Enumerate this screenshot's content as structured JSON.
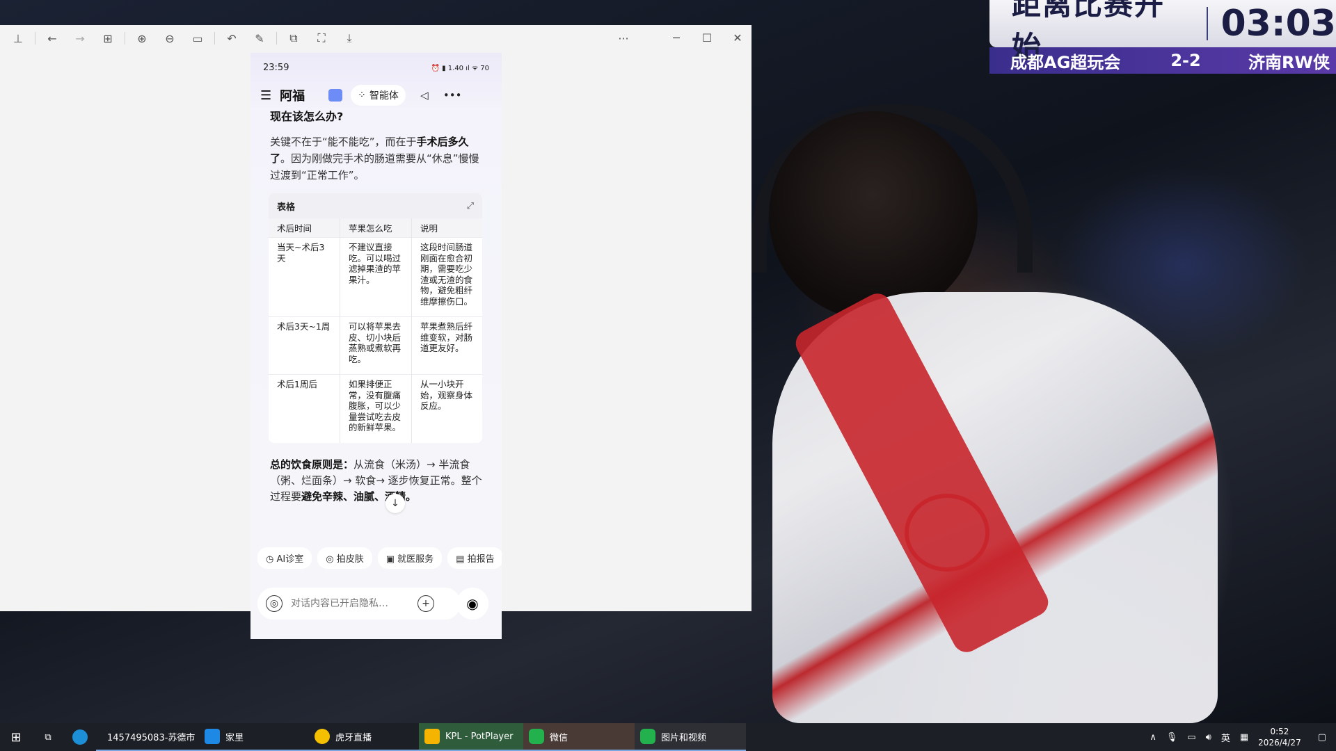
{
  "scoreboard": {
    "title": "距离比赛开始",
    "time": "03:03",
    "team_left": "成都AG超玩会",
    "score": "2-2",
    "team_right": "济南RW侠"
  },
  "viewer": {
    "toolbar_icons": [
      "pin-icon",
      "back-icon",
      "forward-icon",
      "grid-icon",
      "zoom-in-icon",
      "zoom-out-icon",
      "fit-icon",
      "rotate-icon",
      "edit-icon",
      "copy-icon",
      "crop-icon",
      "save-icon"
    ],
    "more": "···",
    "minimize": "─",
    "maximize": "☐",
    "close": "✕"
  },
  "phone": {
    "status_time": "23:59",
    "status_icons": "⏰ ▮ 1.40 ıl ᯤ 70",
    "app_name": "阿福",
    "agent_label": "智能体",
    "question": "现在该怎么办?",
    "para_parts": [
      "关键不在于“能不能吃”，而在于",
      "手术后多久了",
      "。因为刚做完手术的肠道需要从“休息”慢慢过渡到“正常工作”。"
    ],
    "table": {
      "title": "表格",
      "headers": [
        "术后时间",
        "苹果怎么吃",
        "说明"
      ],
      "rows": [
        [
          "当天~术后3天",
          "不建议直接吃。可以喝过滤掉果渣的苹果汁。",
          "这段时间肠道刚面在愈合初期，需要吃少渣或无渣的食物，避免粗纤维摩擦伤口。"
        ],
        [
          "术后3天~1周",
          "可以将苹果去皮、切小块后蒸熟或煮软再吃。",
          "苹果煮熟后纤维变软，对肠道更友好。"
        ],
        [
          "术后1周后",
          "如果排便正常，没有腹痛腹胀，可以少量尝试吃去皮的新鲜苹果。",
          "从一小块开始，观察身体反应。"
        ]
      ]
    },
    "summary_parts": [
      "总的饮食原则是：",
      "从流食（米汤）→ 半流食（粥、烂面条）→ 软食→ 逐步恢复正常。整个过程要",
      "避免辛辣、油腻、酒精。"
    ],
    "down_arrow": "↓",
    "quick_actions": [
      "AI诊室",
      "拍皮肤",
      "就医服务",
      "拍报告"
    ],
    "input_placeholder": "对话内容已开启隐私…",
    "voice_glyph": "◎",
    "plus_glyph": "+",
    "camera_glyph": "◉"
  },
  "taskbar": {
    "items": [
      {
        "label": "1457495083-苏德市",
        "color": "#f5b400"
      },
      {
        "label": "家里",
        "color": "#1e88e5"
      },
      {
        "label": "虎牙直播",
        "color": "#f5c000"
      },
      {
        "label": "KPL - PotPlayer",
        "color": "#f5b400"
      },
      {
        "label": "微信",
        "color": "#22b14c"
      },
      {
        "label": "图片和视频",
        "color": "#22b14c"
      }
    ],
    "tray_lang": "英",
    "time": "0:52",
    "date": "2026/4/27"
  }
}
